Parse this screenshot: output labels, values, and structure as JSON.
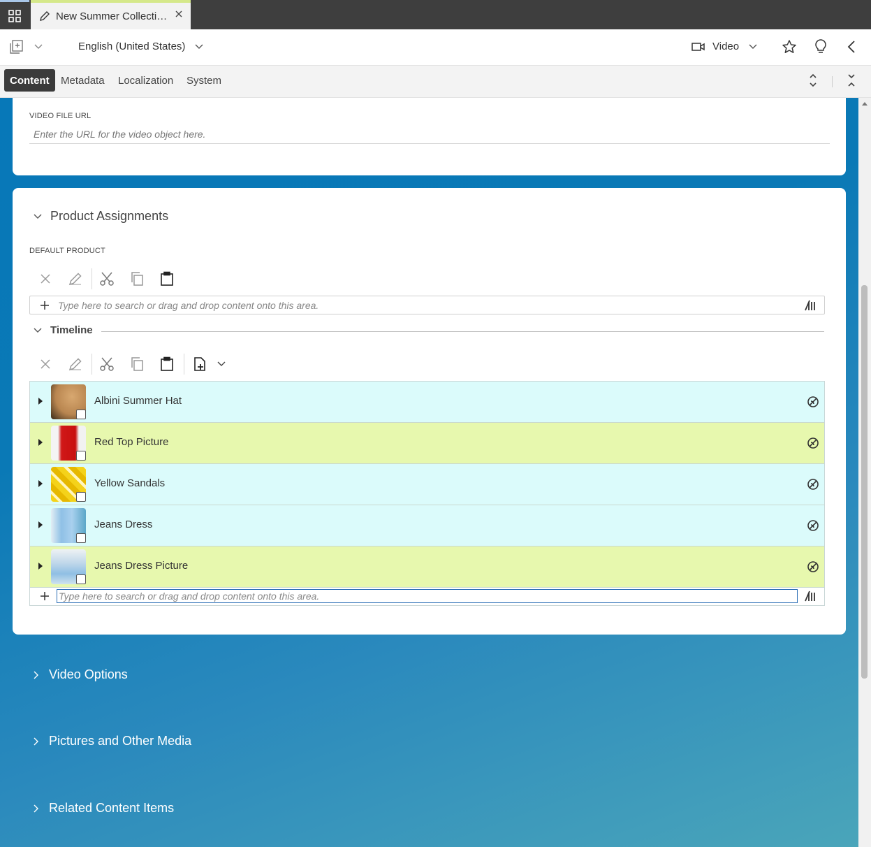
{
  "tab": {
    "title": "New Summer Collecti…"
  },
  "toolbar": {
    "locale": "English (United States)",
    "type": "Video"
  },
  "form_tabs": [
    "Content",
    "Metadata",
    "Localization",
    "System"
  ],
  "video_card": {
    "label": "VIDEO FILE URL",
    "placeholder": "Enter the URL for the video object here."
  },
  "product_assignments": {
    "title": "Product Assignments",
    "default_product_label": "DEFAULT PRODUCT",
    "search_placeholder": "Type here to search or drag and drop content onto this area.",
    "timeline_label": "Timeline",
    "timeline_items": [
      {
        "label": "Albini Summer Hat",
        "kind": "product",
        "bg": "#dbfbfb",
        "thumb": "hat"
      },
      {
        "label": "Red Top Picture",
        "kind": "picture",
        "bg": "#e7f8ae",
        "thumb": "red"
      },
      {
        "label": "Yellow Sandals",
        "kind": "product",
        "bg": "#dbfbfb",
        "thumb": "yellow"
      },
      {
        "label": "Jeans Dress",
        "kind": "product",
        "bg": "#dbfbfb",
        "thumb": "blue"
      },
      {
        "label": "Jeans Dress Picture",
        "kind": "picture",
        "bg": "#e7f8ae",
        "thumb": "blue2"
      }
    ],
    "timeline_placeholder": "Type here to search or drag and drop content onto this area."
  },
  "collapsed_sections": [
    "Video Options",
    "Pictures and Other Media",
    "Related Content Items"
  ],
  "colors": {
    "accent_tab": "#d5e88a",
    "product_row": "#dbfbfb",
    "picture_row": "#e7f8ae",
    "focus_border": "#2a6db5"
  }
}
